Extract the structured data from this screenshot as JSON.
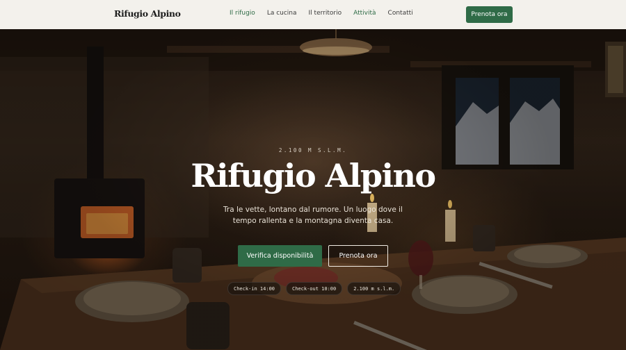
{
  "header": {
    "brand": "Rifugio Alpino",
    "nav": [
      {
        "label": "Il rifugio"
      },
      {
        "label": "La cucina"
      },
      {
        "label": "Il territorio"
      },
      {
        "label": "Attività"
      },
      {
        "label": "Contatti"
      }
    ],
    "cta_label": "Prenota ora"
  },
  "hero": {
    "eyebrow": "2.100 M S.L.M.",
    "title": "Rifugio Alpino",
    "subtitle": "Tra le vette, lontano dal rumore. Un luogo dove il tempo rallenta e la montagna diventa casa.",
    "primary_button": "Verifica disponibilità",
    "secondary_button": "Prenota ora",
    "chips": [
      {
        "label": "Check-in 14:00"
      },
      {
        "label": "Check-out 10:00"
      },
      {
        "label": "2.100 m s.l.m."
      }
    ]
  },
  "colors": {
    "accent": "#2f6b47",
    "nav_active": "#2d6a45",
    "header_bg": "#f3f1ec"
  }
}
